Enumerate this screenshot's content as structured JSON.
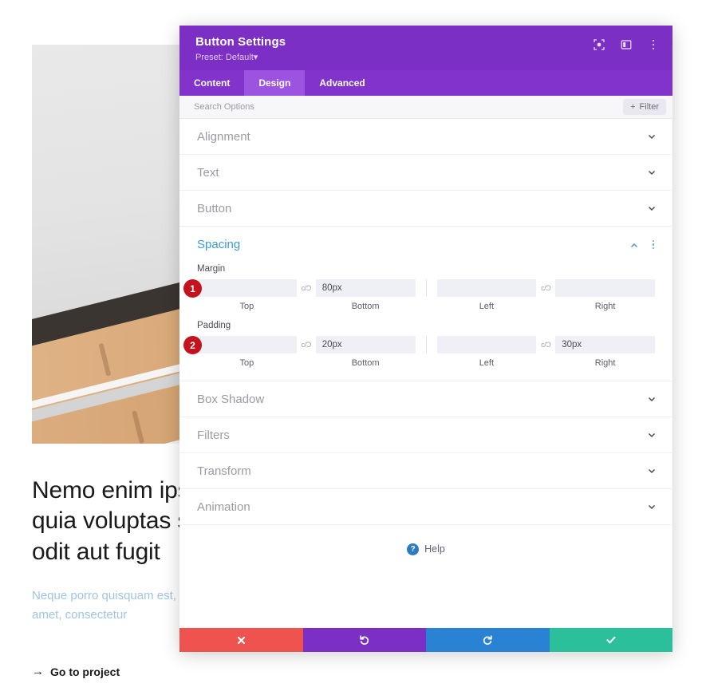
{
  "preview": {
    "heading": "Nemo enim ipsam voluptatem quia voluptas sit aspernatur aut odit aut fugit",
    "subtext": "Neque porro quisquam est, qui dolorem ipsum quia dolor sit amet, consectetur",
    "cta_arrow": "→",
    "cta_label": "Go to project"
  },
  "modal": {
    "title": "Button Settings",
    "preset": "Preset: Default",
    "preset_caret": "▾",
    "header_icons": [
      {
        "name": "focus-icon",
        "label": "focus"
      },
      {
        "name": "layout-icon",
        "label": "layout"
      },
      {
        "name": "more-vertical-icon",
        "label": "more"
      }
    ],
    "tabs": [
      {
        "label": "Content",
        "active": false
      },
      {
        "label": "Design",
        "active": true
      },
      {
        "label": "Advanced",
        "active": false
      }
    ],
    "search": {
      "placeholder": "Search Options",
      "value": "",
      "filter_label": "Filter",
      "filter_plus": "+"
    },
    "sections_above": [
      {
        "label": "Alignment"
      },
      {
        "label": "Text"
      },
      {
        "label": "Button"
      }
    ],
    "spacing": {
      "title": "Spacing",
      "margin": {
        "title": "Margin",
        "badge": "1",
        "link_icon": "c/Ɔ",
        "fields": [
          {
            "label": "Top",
            "value": ""
          },
          {
            "label": "Bottom",
            "value": "80px"
          },
          {
            "label": "Left",
            "value": ""
          },
          {
            "label": "Right",
            "value": ""
          }
        ]
      },
      "padding": {
        "title": "Padding",
        "badge": "2",
        "link_icon": "c/Ɔ",
        "fields": [
          {
            "label": "Top",
            "value": ""
          },
          {
            "label": "Bottom",
            "value": "20px"
          },
          {
            "label": "Left",
            "value": ""
          },
          {
            "label": "Right",
            "value": "30px"
          }
        ]
      }
    },
    "sections_below": [
      {
        "label": "Box Shadow"
      },
      {
        "label": "Filters"
      },
      {
        "label": "Transform"
      },
      {
        "label": "Animation"
      }
    ],
    "help": {
      "icon_char": "?",
      "label": "Help"
    },
    "footer_buttons": [
      {
        "name": "cancel-button",
        "icon": "close-icon",
        "color": "#ef5350"
      },
      {
        "name": "undo-button",
        "icon": "undo-icon",
        "color": "#7b2fc4"
      },
      {
        "name": "redo-button",
        "icon": "redo-icon",
        "color": "#2a82d4"
      },
      {
        "name": "save-button",
        "icon": "check-icon",
        "color": "#2bbf9b"
      }
    ]
  },
  "colors": {
    "header_purple": "#7b2fc4",
    "tabbar_purple": "#8133cc",
    "tab_active_purple": "#9c54e0",
    "section_active_blue": "#3b9bd6",
    "badge_red": "#c4131d",
    "cancel_red": "#ef5350",
    "undo_purple": "#7b2fc4",
    "redo_blue": "#2a82d4",
    "save_teal": "#2bbf9b"
  }
}
